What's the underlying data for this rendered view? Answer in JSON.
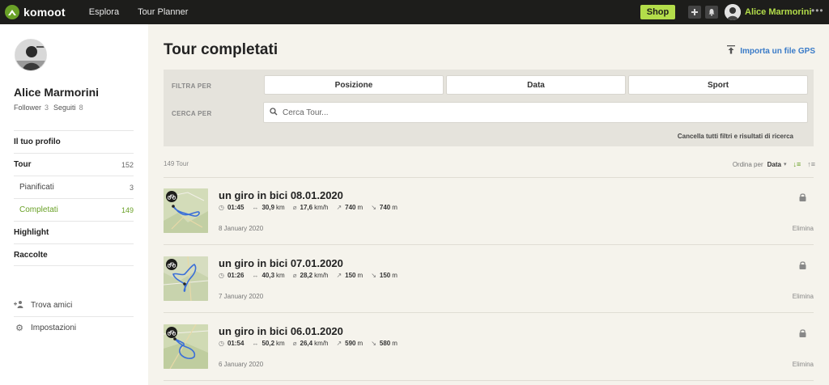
{
  "topbar": {
    "logo_text": "komoot",
    "nav": [
      "Esplora",
      "Tour Planner"
    ],
    "shop_label": "Shop",
    "user_name": "Alice Marmorini",
    "more": "•••"
  },
  "profile": {
    "name": "Alice Marmorini",
    "follower_label": "Follower",
    "follower_count": "3",
    "following_label": "Seguiti",
    "following_count": "8"
  },
  "sidebar": {
    "items": [
      {
        "label": "Il tuo profilo",
        "count": ""
      },
      {
        "label": "Tour",
        "count": "152"
      },
      {
        "label": "Pianificati",
        "count": "3"
      },
      {
        "label": "Completati",
        "count": "149"
      },
      {
        "label": "Highlight",
        "count": ""
      },
      {
        "label": "Raccolte",
        "count": ""
      }
    ],
    "actions": [
      {
        "label": "Trova amici",
        "icon": "add-friends-icon"
      },
      {
        "label": "Impostazioni",
        "icon": "gear-icon"
      }
    ]
  },
  "main": {
    "title": "Tour completati",
    "import_label": "Importa un file GPS",
    "filter_label": "FILTRA PER",
    "filters": [
      "Posizione",
      "Data",
      "Sport"
    ],
    "search_label": "CERCA PER",
    "search_placeholder": "Cerca Tour...",
    "clear_label": "Cancella tutti filtri e risultati di ricerca",
    "count_label": "149 Tour",
    "sort_label": "Ordina per",
    "sort_value": "Data"
  },
  "tours": [
    {
      "title": "un giro in bici 08.01.2020",
      "time": "01:45",
      "distance": "30,9",
      "distance_unit": "km",
      "speed": "17,6",
      "speed_unit": "km/h",
      "up": "740",
      "up_unit": "m",
      "down": "740",
      "down_unit": "m",
      "date": "8 January 2020",
      "delete_label": "Elimina"
    },
    {
      "title": "un giro in bici 07.01.2020",
      "time": "01:26",
      "distance": "40,3",
      "distance_unit": "km",
      "speed": "28,2",
      "speed_unit": "km/h",
      "up": "150",
      "up_unit": "m",
      "down": "150",
      "down_unit": "m",
      "date": "7 January 2020",
      "delete_label": "Elimina"
    },
    {
      "title": "un giro in bici 06.01.2020",
      "time": "01:54",
      "distance": "50,2",
      "distance_unit": "km",
      "speed": "26,4",
      "speed_unit": "km/h",
      "up": "590",
      "up_unit": "m",
      "down": "580",
      "down_unit": "m",
      "date": "6 January 2020",
      "delete_label": "Elimina"
    }
  ],
  "colors": {
    "accent": "#6aa127",
    "shop": "#b3dd4a",
    "link": "#3a7bc8",
    "topbar": "#1d1d1b",
    "route": "#3b6fd8"
  }
}
